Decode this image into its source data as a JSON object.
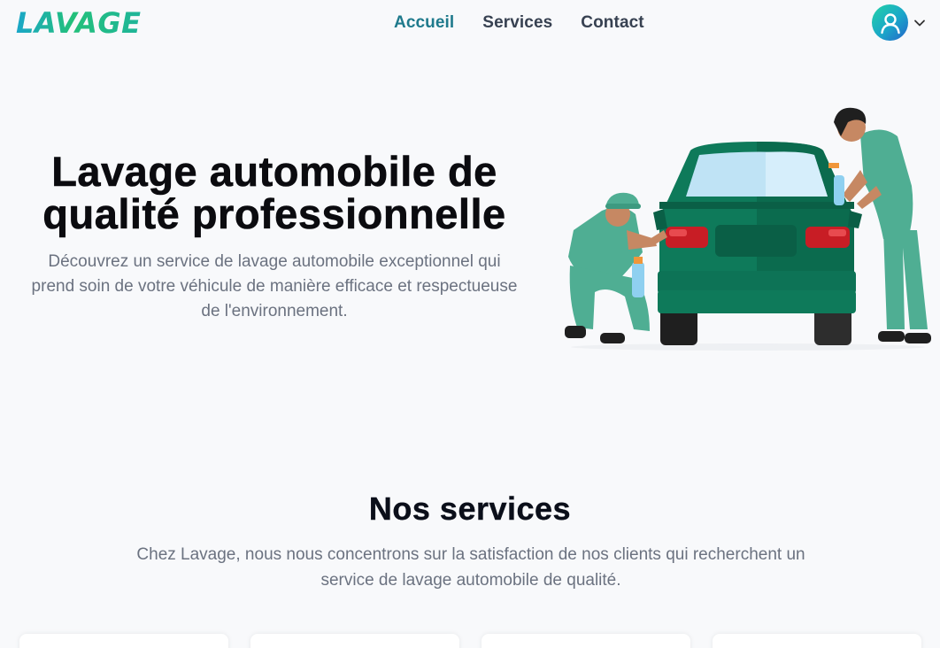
{
  "brand": {
    "logo_text": "LAVAGE",
    "colors": {
      "primary": "#1f7a8c",
      "green": "#23c07a",
      "teal": "#1aa6c9"
    }
  },
  "nav": {
    "items": [
      {
        "label": "Accueil",
        "active": true
      },
      {
        "label": "Services",
        "active": false
      },
      {
        "label": "Contact",
        "active": false
      }
    ]
  },
  "user_menu": {
    "icon": "user-avatar-icon",
    "chevron": "chevron-down-icon"
  },
  "hero": {
    "title": "Lavage automobile de qualité professionnelle",
    "subtitle": "Découvrez un service de lavage automobile exceptionnel qui prend soin de votre véhicule de manière efficace et respectueuse de l'environnement.",
    "illustration": "car-wash-illustration"
  },
  "services": {
    "title": "Nos services",
    "subtitle": "Chez Lavage, nous nous concentrons sur la satisfaction de nos clients qui recherchent un service de lavage automobile de qualité.",
    "cards_visible": 4
  }
}
